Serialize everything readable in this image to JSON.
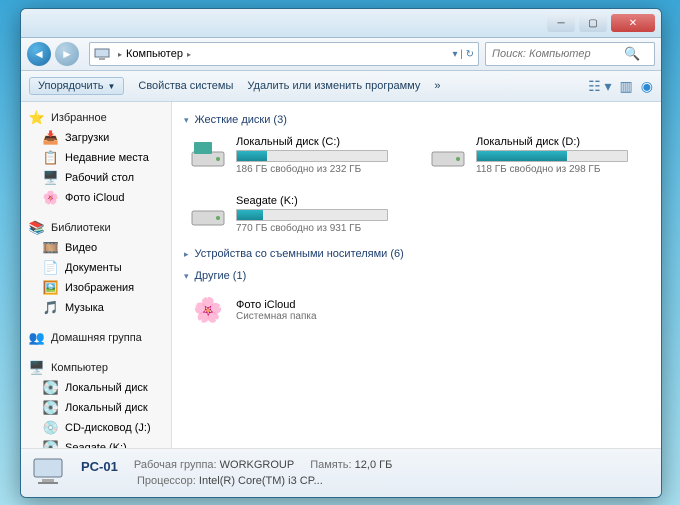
{
  "titlebar": {},
  "nav": {
    "crumb1": "Компьютер",
    "search_placeholder": "Поиск: Компьютер"
  },
  "toolbar": {
    "organize": "Упорядочить",
    "properties": "Свойства системы",
    "uninstall": "Удалить или изменить программу",
    "more": "»"
  },
  "sidebar": {
    "favorites": {
      "label": "Избранное",
      "items": [
        {
          "label": "Загрузки"
        },
        {
          "label": "Недавние места"
        },
        {
          "label": "Рабочий стол"
        },
        {
          "label": "Фото iCloud"
        }
      ]
    },
    "libraries": {
      "label": "Библиотеки",
      "items": [
        {
          "label": "Видео"
        },
        {
          "label": "Документы"
        },
        {
          "label": "Изображения"
        },
        {
          "label": "Музыка"
        }
      ]
    },
    "homegroup": {
      "label": "Домашняя группа"
    },
    "computer": {
      "label": "Компьютер",
      "items": [
        {
          "label": "Локальный диск"
        },
        {
          "label": "Локальный диск"
        },
        {
          "label": "CD-дисковод (J:)"
        },
        {
          "label": "Seagate (K:)"
        }
      ]
    }
  },
  "sections": {
    "hdd": {
      "label": "Жесткие диски (3)"
    },
    "removable": {
      "label": "Устройства со съемными носителями (6)"
    },
    "other": {
      "label": "Другие (1)"
    }
  },
  "drives": [
    {
      "name": "Локальный диск (C:)",
      "free": "186 ГБ свободно из 232 ГБ",
      "pct": 20
    },
    {
      "name": "Локальный диск (D:)",
      "free": "118 ГБ свободно из 298 ГБ",
      "pct": 60
    },
    {
      "name": "Seagate (K:)",
      "free": "770 ГБ свободно из 931 ГБ",
      "pct": 17
    }
  ],
  "other_items": [
    {
      "name": "Фото iCloud",
      "sub": "Системная папка"
    }
  ],
  "details": {
    "name": "PC-01",
    "workgroup_label": "Рабочая группа:",
    "workgroup": "WORKGROUP",
    "memory_label": "Память:",
    "memory": "12,0 ГБ",
    "cpu_label": "Процессор:",
    "cpu": "Intel(R) Core(TM) i3 CP..."
  }
}
